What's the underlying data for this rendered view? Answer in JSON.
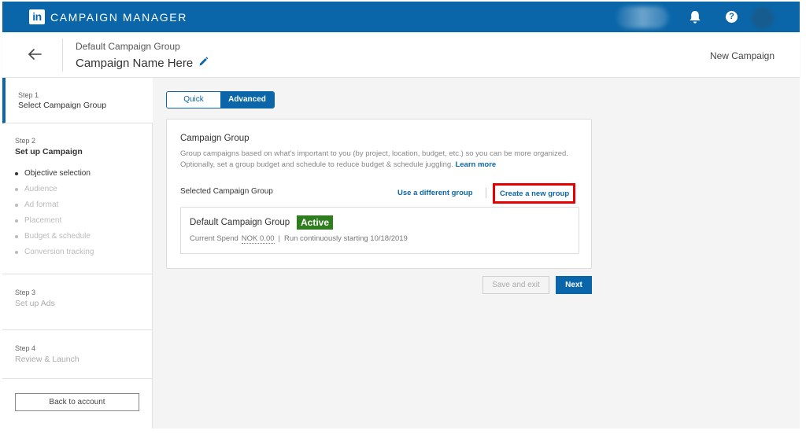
{
  "topbar": {
    "logo_text": "in",
    "brand": "CAMPAIGN MANAGER",
    "icons": [
      "bell-icon",
      "help-icon"
    ],
    "help_glyph": "?"
  },
  "header": {
    "back_icon": "arrow-left-icon",
    "group_name": "Default Campaign Group",
    "campaign_name": "Campaign Name Here",
    "edit_icon": "pencil-icon",
    "right_label": "New Campaign"
  },
  "sidebar": {
    "steps": [
      {
        "number": "Step 1",
        "title": "Select Campaign Group"
      },
      {
        "number": "Step 2",
        "title": "Set up Campaign"
      },
      {
        "number": "Step 3",
        "title": "Set up Ads"
      },
      {
        "number": "Step 4",
        "title": "Review & Launch"
      }
    ],
    "substeps": [
      "Objective selection",
      "Audience",
      "Ad format",
      "Placement",
      "Budget & schedule",
      "Conversion tracking"
    ],
    "back_button": "Back to account"
  },
  "mode_toggle": {
    "quick": "Quick",
    "advanced": "Advanced",
    "selected": "Advanced"
  },
  "card": {
    "title": "Campaign Group",
    "description": "Group campaigns based on what's important to you (by project, location, budget, etc.) so you can be more organized. Optionally, set a group budget and schedule to reduce budget & schedule juggling.",
    "learn_more": "Learn more",
    "selected_label": "Selected Campaign Group",
    "use_different": "Use a different group",
    "create_new": "Create a new group",
    "group": {
      "name": "Default Campaign Group",
      "status": "Active",
      "spend_label": "Current Spend",
      "spend_value": "NOK 0.00",
      "separator": "|",
      "schedule": "Run continuously starting 10/18/2019"
    }
  },
  "actions": {
    "save_exit": "Save and exit",
    "next": "Next"
  },
  "colors": {
    "brand": "#0a66a8",
    "active_badge": "#2e7d1e",
    "highlight": "#e60000",
    "background": "#f4f4f4"
  }
}
